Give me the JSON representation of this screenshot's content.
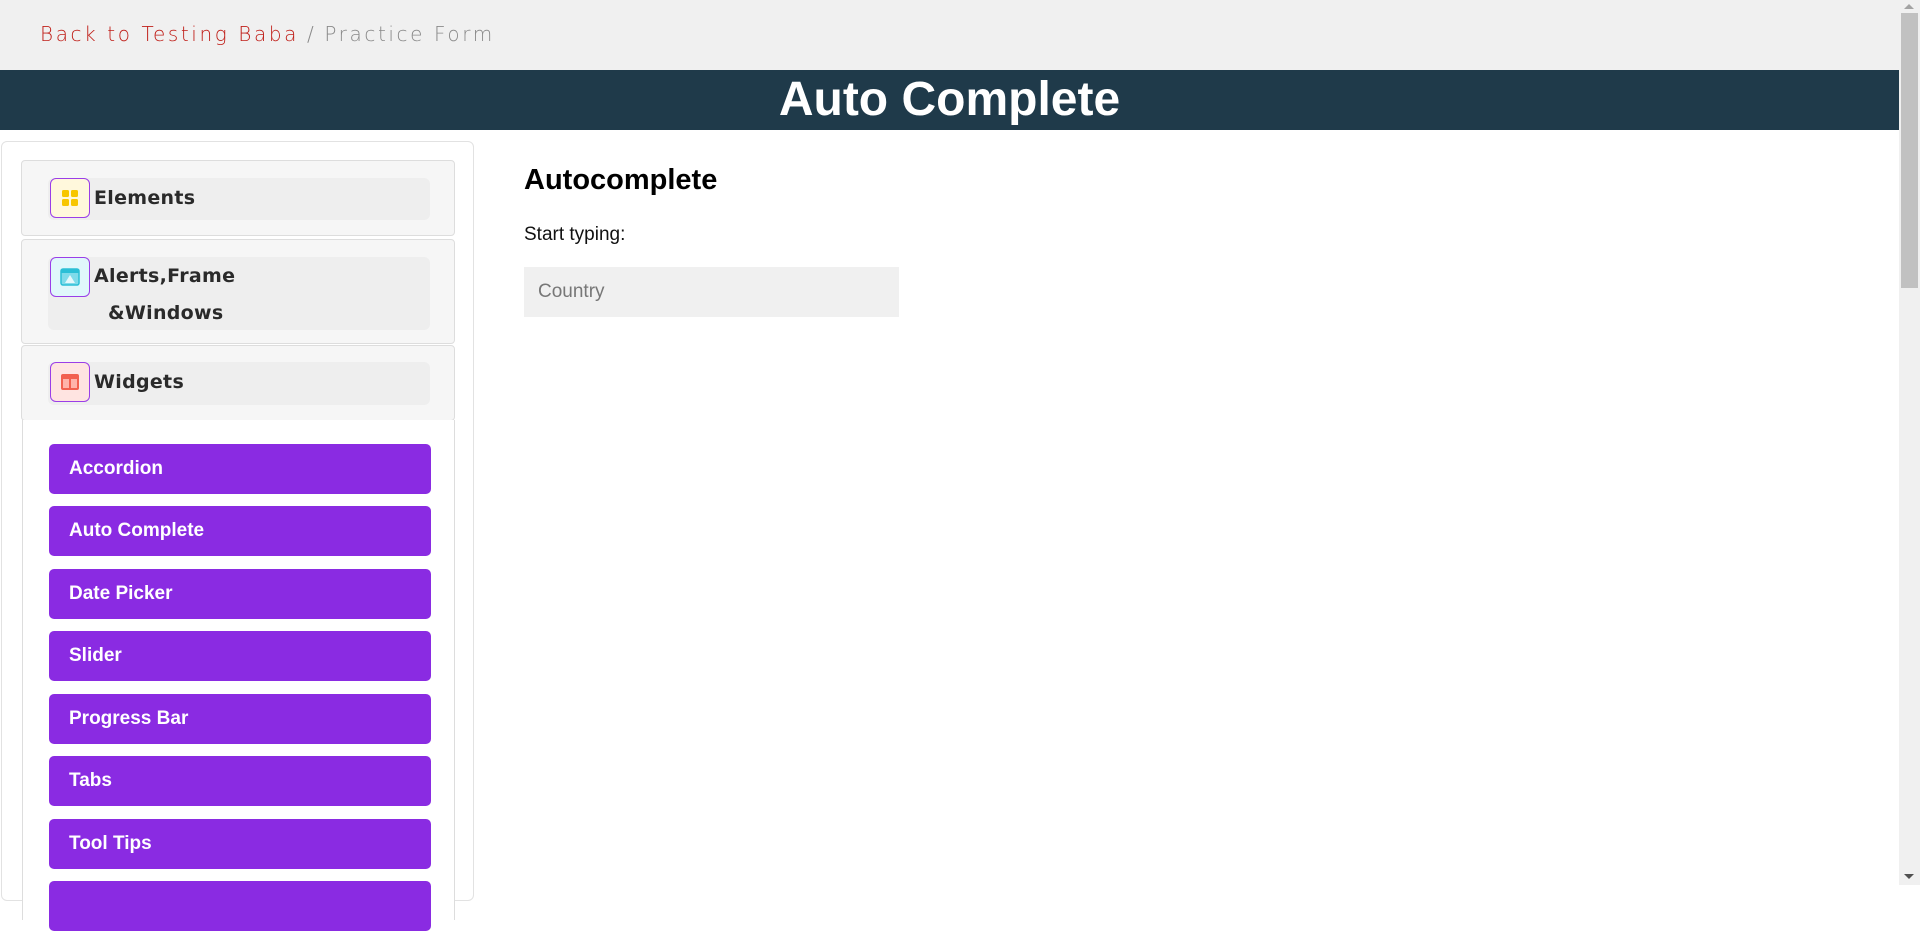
{
  "breadcrumb": {
    "back": "Back to Testing Baba",
    "separator": "/",
    "current": "Practice Form"
  },
  "banner": {
    "title": "Auto Complete"
  },
  "sidebar": {
    "sections": [
      {
        "label": "Elements",
        "icon": "elements-grid-icon"
      },
      {
        "label_line1": "Alerts,Frame",
        "label_line2": "&Windows",
        "icon": "window-alert-icon"
      },
      {
        "label": "Widgets",
        "icon": "widgets-icon"
      }
    ],
    "widgets": [
      "Accordion",
      "Auto Complete",
      "Date Picker",
      "Slider",
      "Progress Bar",
      "Tabs",
      "Tool Tips"
    ]
  },
  "main": {
    "heading": "Autocomplete",
    "label": "Start typing:",
    "input_placeholder": "Country",
    "input_value": ""
  },
  "colors": {
    "banner": "#1f3a4a",
    "button": "#8a2be2",
    "back_link": "#c0201a"
  }
}
